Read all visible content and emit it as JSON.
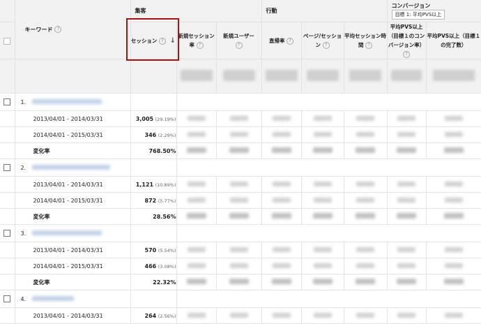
{
  "header": {
    "keyword_label": "キーワード",
    "group_acquisition": "集客",
    "group_behavior": "行動",
    "group_conversion": "コンバージョン",
    "goal_select": "目標 1: 平均PVS以上",
    "col_sessions": "セッション",
    "col_new_session_rate": "新規セッション率",
    "col_new_users": "新規ユーザー",
    "col_bounce_rate": "直帰率",
    "col_pages_per_session": "ページ/セッション",
    "col_avg_session_duration": "平均セッション時間",
    "col_goal_cvr": "平均PVS以上（目標１のコンバージョン率）",
    "col_goal_completions": "平均PVS以上（目標１の完了数）"
  },
  "rows": [
    {
      "index": "1.",
      "period1": "2013/04/01 - 2014/03/31",
      "sessions1": "3,005",
      "pct1": "(29.19%)",
      "period2": "2014/04/01 - 2015/03/31",
      "sessions2": "346",
      "pct2": "(2.29%)",
      "change_label": "変化率",
      "change": "768.50%"
    },
    {
      "index": "2.",
      "period1": "2013/04/01 - 2014/03/31",
      "sessions1": "1,121",
      "pct1": "(10.89%)",
      "period2": "2014/04/01 - 2015/03/31",
      "sessions2": "872",
      "pct2": "(5.77%)",
      "change_label": "変化率",
      "change": "28.56%"
    },
    {
      "index": "3.",
      "period1": "2013/04/01 - 2014/03/31",
      "sessions1": "570",
      "pct1": "(5.54%)",
      "period2": "2014/04/01 - 2015/03/31",
      "sessions2": "466",
      "pct2": "(3.08%)",
      "change_label": "変化率",
      "change": "22.32%"
    },
    {
      "index": "4.",
      "period1": "2013/04/01 - 2014/03/31",
      "sessions1": "264",
      "pct1": "(2.56%)"
    }
  ],
  "icons": {
    "help": "question-icon",
    "sort": "arrow-down-icon",
    "checkbox": "checkbox-icon"
  },
  "colors": {
    "highlight_border": "#a31414",
    "header_bg": "#f2f2f2"
  }
}
